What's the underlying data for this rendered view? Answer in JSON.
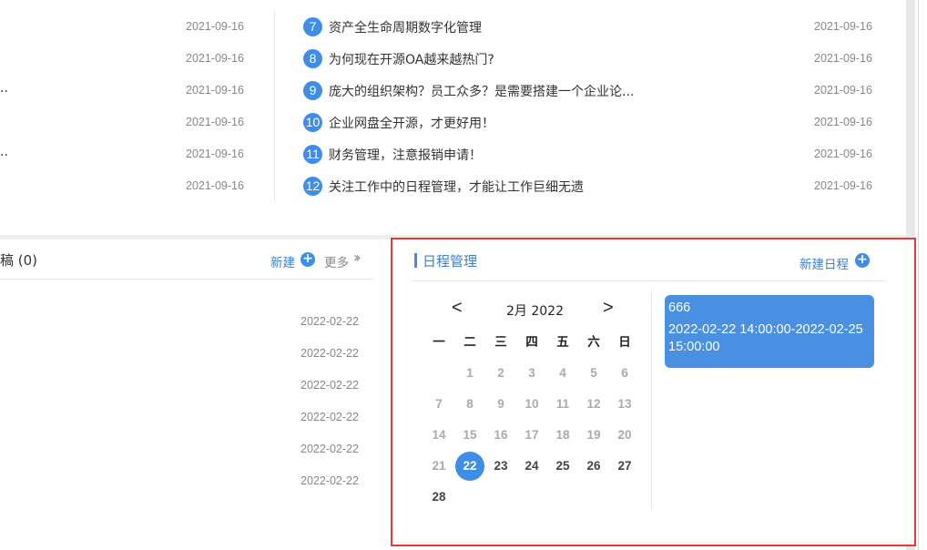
{
  "news": {
    "left_items": [
      {
        "text": "",
        "date": "2021-09-16"
      },
      {
        "text": "",
        "date": "2021-09-16"
      },
      {
        "text": "..",
        "date": "2021-09-16"
      },
      {
        "text": "",
        "date": "2021-09-16"
      },
      {
        "text": "..",
        "date": "2021-09-16"
      },
      {
        "text": "",
        "date": "2021-09-16"
      }
    ],
    "right_items": [
      {
        "num": "7",
        "title": "资产全生命周期数字化管理",
        "date": "2021-09-16"
      },
      {
        "num": "8",
        "title": "为何现在开源OA越来越热门?",
        "date": "2021-09-16"
      },
      {
        "num": "9",
        "title": "庞大的组织架构？员工众多？是需要搭建一个企业论...",
        "date": "2021-09-16"
      },
      {
        "num": "10",
        "title": "企业网盘全开源，才更好用！",
        "date": "2021-09-16"
      },
      {
        "num": "11",
        "title": "财务管理，注意报销申请！",
        "date": "2021-09-16"
      },
      {
        "num": "12",
        "title": "关注工作中的日程管理，才能让工作巨细无遗",
        "date": "2021-09-16"
      }
    ]
  },
  "drafts": {
    "title": "稿 (0)",
    "new_label": "新建",
    "more_label": "更多",
    "items": [
      {
        "date": "2022-02-22"
      },
      {
        "date": "2022-02-22"
      },
      {
        "date": "2022-02-22"
      },
      {
        "date": "2022-02-22"
      },
      {
        "date": "2022-02-22"
      },
      {
        "date": "2022-02-22"
      }
    ]
  },
  "schedule": {
    "title": "日程管理",
    "new_label": "新建日程",
    "calendar": {
      "prev": "<",
      "next": ">",
      "month_label": "2月 2022",
      "weekdays": [
        "一",
        "二",
        "三",
        "四",
        "五",
        "六",
        "日"
      ],
      "days": [
        "1",
        "2",
        "3",
        "4",
        "5",
        "6",
        "7",
        "8",
        "9",
        "10",
        "11",
        "12",
        "13",
        "14",
        "15",
        "16",
        "17",
        "18",
        "19",
        "20",
        "21",
        "22",
        "23",
        "24",
        "25",
        "26",
        "27",
        "28"
      ],
      "first_weekday_index": 1,
      "today": "22"
    },
    "event": {
      "name": "666",
      "time": "2022-02-22 14:00:00-2022-02-25 15:00:00"
    }
  },
  "colors": {
    "accent": "#3e8ee8",
    "highlight_border": "#e23b3b",
    "event_bg": "#4a90e2"
  }
}
